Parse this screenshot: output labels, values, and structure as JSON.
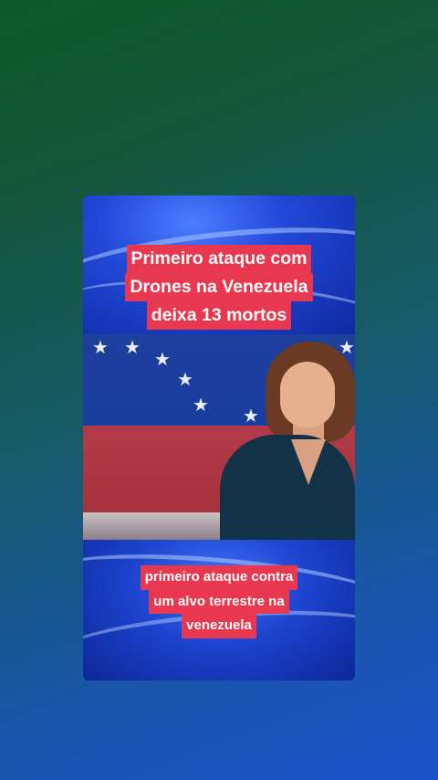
{
  "video_card": {
    "headline_lines": [
      "Primeiro ataque com",
      "Drones na Venezuela",
      "deixa 13 mortos"
    ],
    "subtitle_lines": [
      "primeiro ataque contra",
      "um alvo terrestre na",
      "venezuela"
    ]
  },
  "colors": {
    "caption_background": "#e8384f",
    "caption_text": "#ffffff",
    "page_gradient_top": "#0f5a2a",
    "page_gradient_bottom": "#1d52cc"
  }
}
